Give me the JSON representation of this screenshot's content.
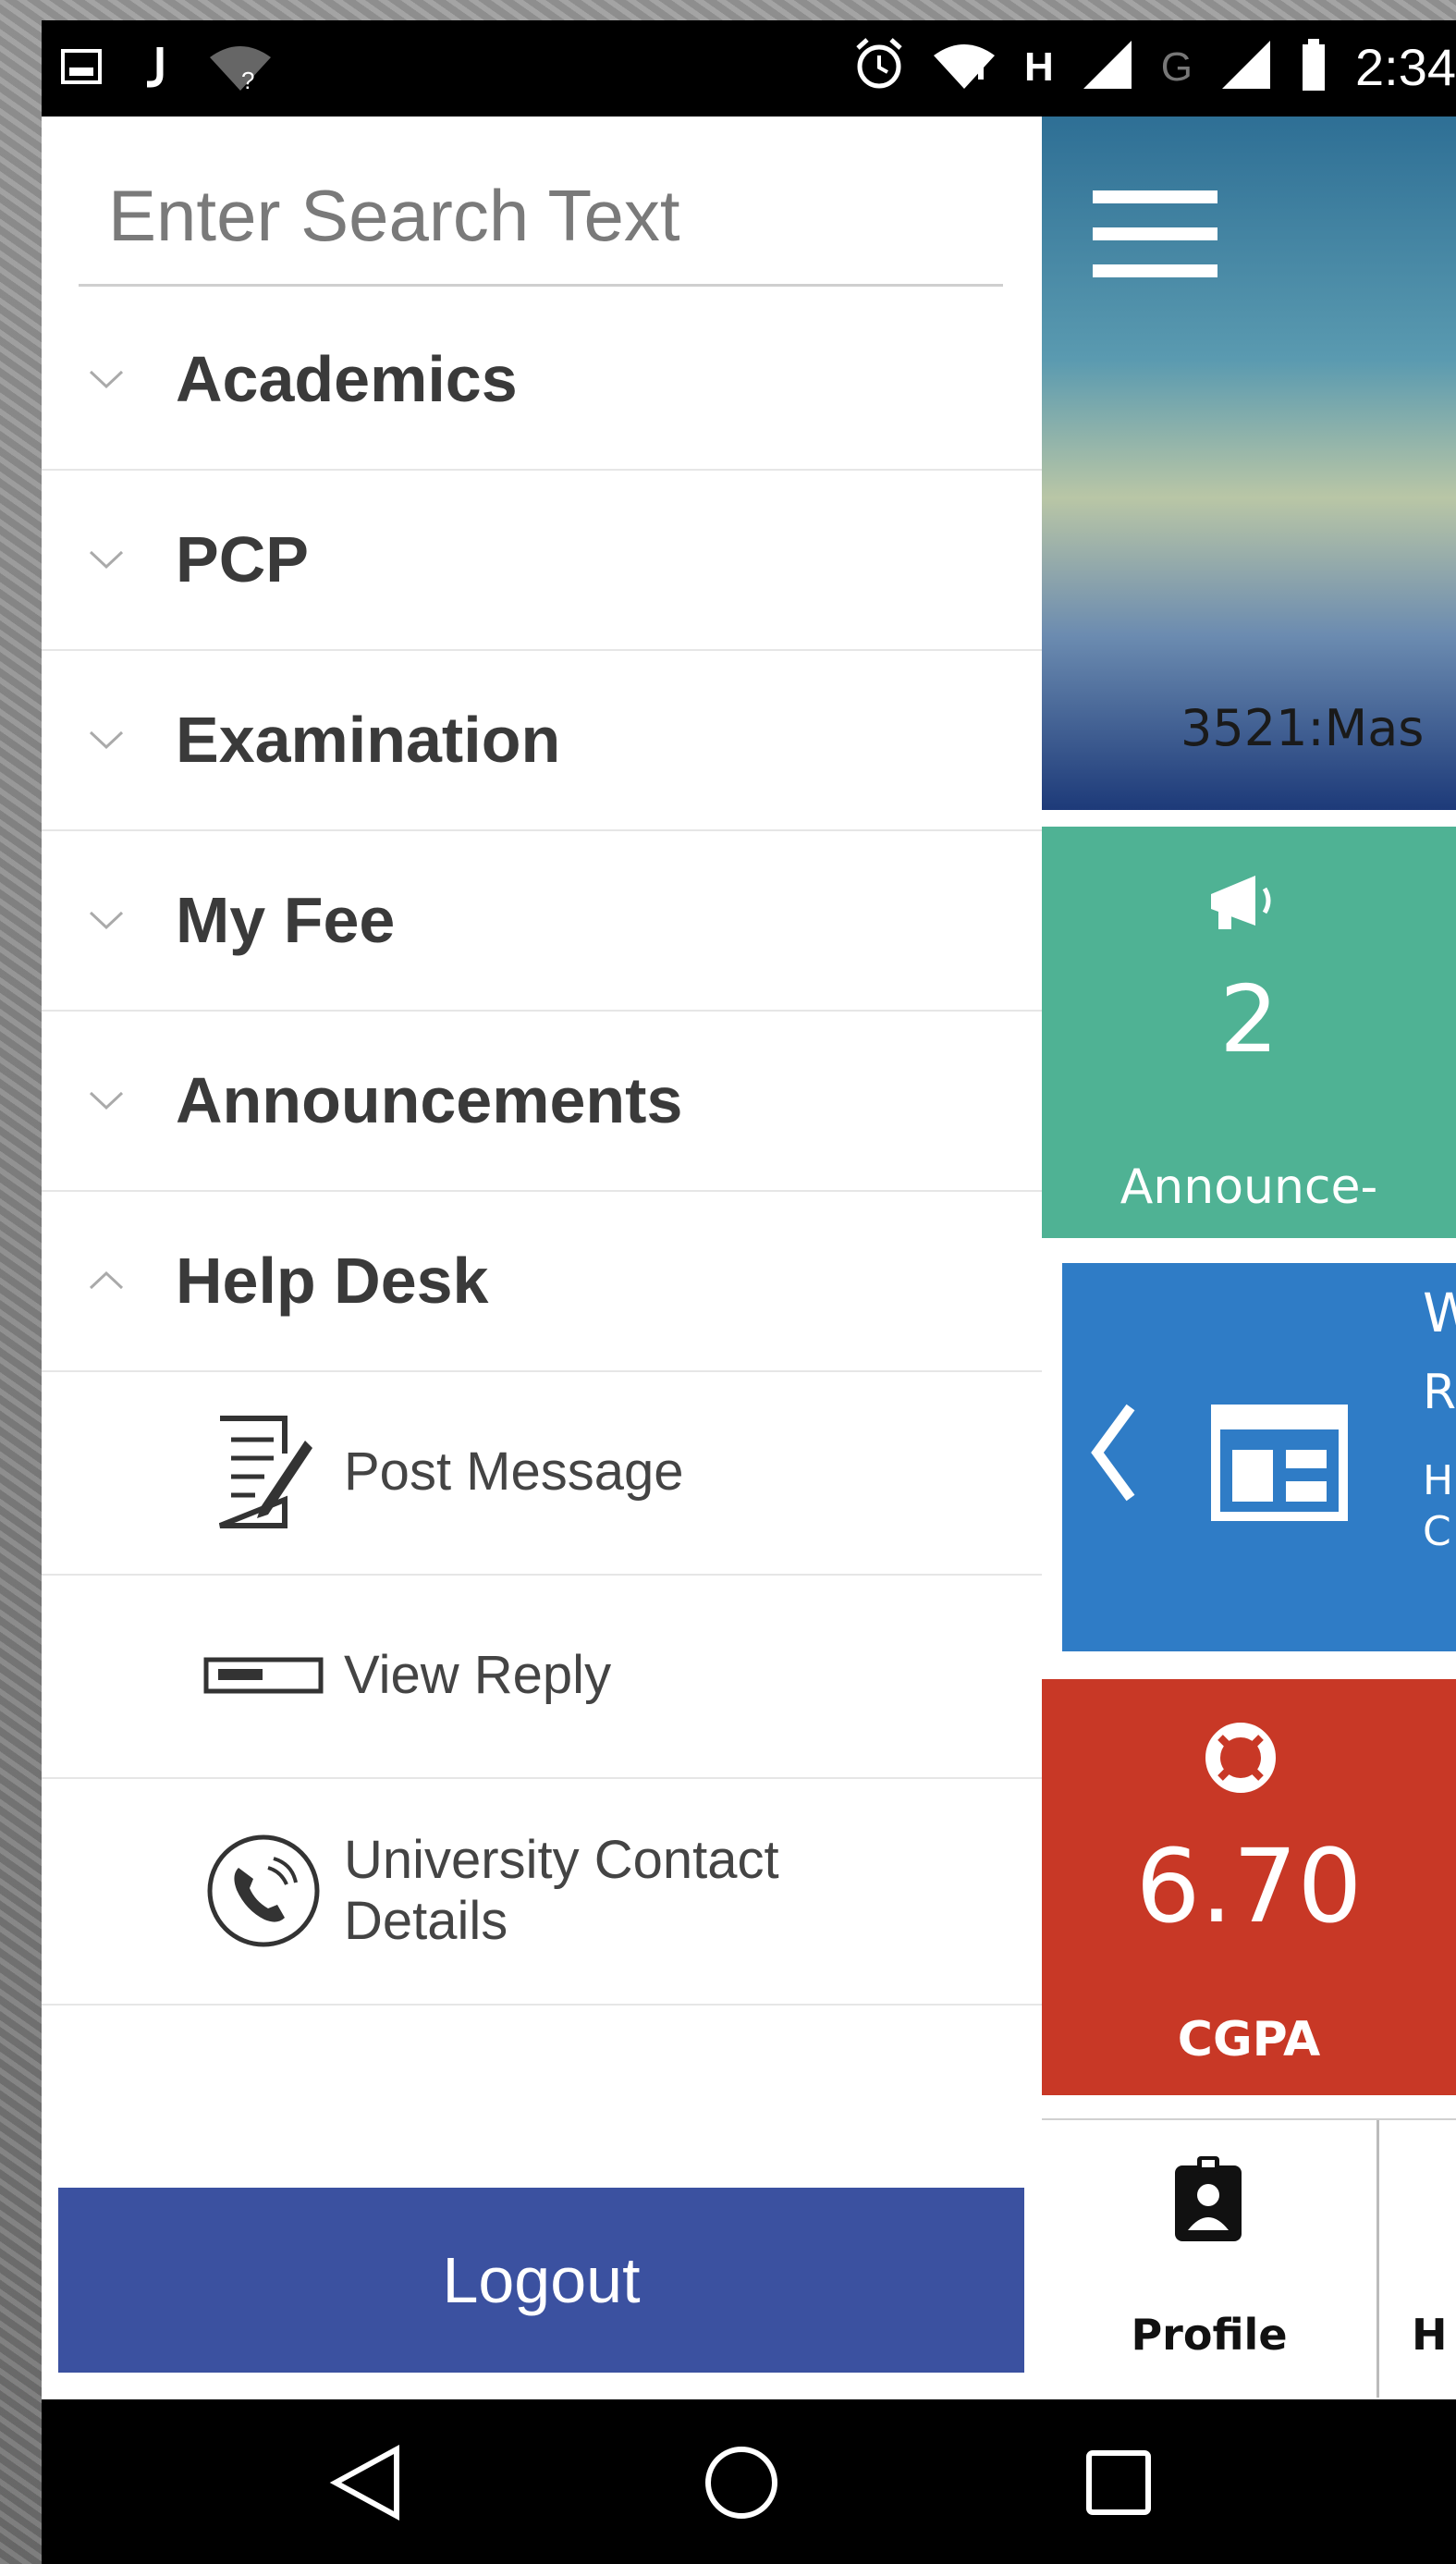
{
  "status_bar": {
    "time": "2:34",
    "left_icons": [
      "image-icon",
      "j-notification-icon",
      "wifi-unknown-icon"
    ],
    "right_icons": [
      "alarm-icon",
      "wifi-alert-icon",
      "h-network-label",
      "signal-icon",
      "g-network-label",
      "signal-icon",
      "battery-icon"
    ],
    "h_label": "H",
    "g_label": "G"
  },
  "drawer": {
    "search_placeholder": "Enter Search Text",
    "menu": [
      {
        "label": "Academics",
        "expanded": false
      },
      {
        "label": "PCP",
        "expanded": false
      },
      {
        "label": "Examination",
        "expanded": false
      },
      {
        "label": "My Fee",
        "expanded": false
      },
      {
        "label": "Announcements",
        "expanded": false
      },
      {
        "label": "Help Desk",
        "expanded": true
      }
    ],
    "help_desk_items": [
      {
        "label": "Post Message",
        "icon": "edit-document-icon"
      },
      {
        "label": "View Reply",
        "icon": "reply-box-icon"
      },
      {
        "label": "University Contact",
        "label2": "Details",
        "icon": "phone-contact-icon"
      }
    ],
    "logout_label": "Logout"
  },
  "content": {
    "banner_text": "3521:Mas",
    "announcement_tile": {
      "count": "2",
      "caption": "Announce-",
      "icon": "megaphone-icon",
      "color": "#4fb294"
    },
    "blue_tile": {
      "line1": "W",
      "line2": "R",
      "line3": "H",
      "line4": "C",
      "icon": "calendar-icon",
      "color": "#2f7cc6"
    },
    "cgpa_tile": {
      "value": "6.70",
      "caption": "CGPA",
      "icon": "lifebuoy-icon",
      "color": "#c83826"
    },
    "tabs": {
      "profile": "Profile",
      "next_partial": "H"
    }
  },
  "nav": {
    "back": "back-icon",
    "home": "home-icon",
    "recents": "recents-icon"
  }
}
